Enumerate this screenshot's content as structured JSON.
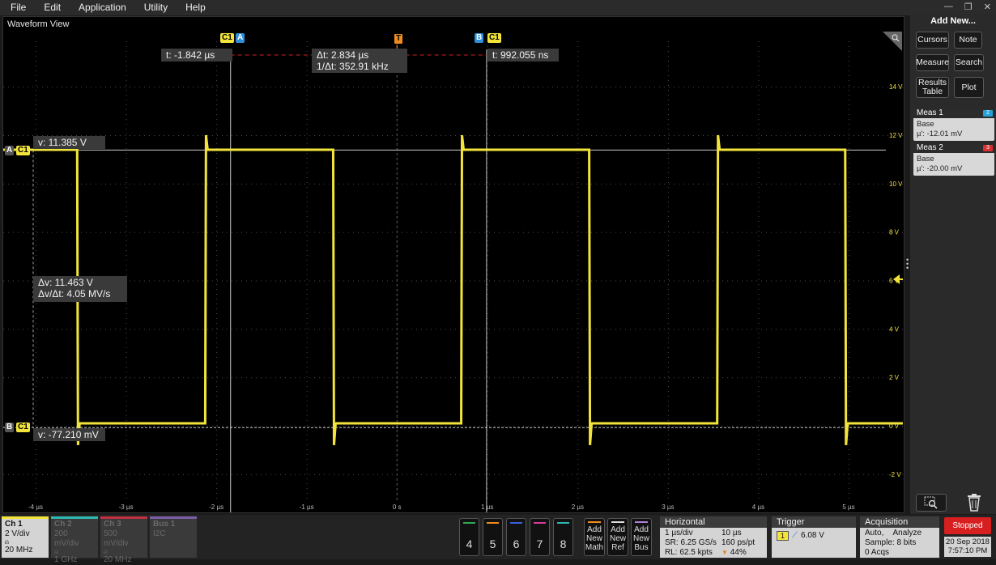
{
  "menu": [
    "File",
    "Edit",
    "Application",
    "Utility",
    "Help"
  ],
  "waveform_view": {
    "title": "Waveform View",
    "cursor_a_time": "t: -1.842 µs",
    "cursor_b_time": "t: 992.055 ns",
    "delta_t": "Δt: 2.834 µs",
    "inv_delta_t": "1/Δt:  352.91 kHz",
    "cursor_a_voltage": "v: 11.385 V",
    "cursor_b_voltage": "v: -77.210 mV",
    "delta_v": "Δv: 11.463 V",
    "dv_dt": "Δv/Δt:  4.05 MV/s",
    "tags": {
      "c1": "C1",
      "a": "A",
      "b": "B",
      "t": "T"
    },
    "y_ticks": [
      "14 V",
      "12 V",
      "10 V",
      "8 V",
      "6 V",
      "4 V",
      "2 V",
      "0 V",
      "-2 V"
    ],
    "x_ticks": [
      "-4 µs",
      "-3 µs",
      "-2 µs",
      "-1 µs",
      "0 s",
      "1 µs",
      "2 µs",
      "3 µs",
      "4 µs",
      "5 µs"
    ],
    "waveform_color": "#f2e43a"
  },
  "right_panel": {
    "title": "Add New...",
    "buttons": [
      "Cursors",
      "Note",
      "Measure",
      "Search",
      "Results Table",
      "Plot"
    ],
    "measurements": [
      {
        "name": "Meas 1",
        "type": "Base",
        "value": "µ': -12.01 mV",
        "badge_color": "#27a0d8"
      },
      {
        "name": "Meas 2",
        "type": "Base",
        "value": "µ': -20.00 mV",
        "badge_color": "#d83030"
      }
    ],
    "icons": [
      "zoom-icon",
      "trash-icon"
    ]
  },
  "channels": [
    {
      "name": "Ch 1",
      "scale": "2 V/div",
      "bw": "20 MHz",
      "active": true,
      "color": "#f2e43a"
    },
    {
      "name": "Ch 2",
      "scale": "200 mV/div",
      "bw": "1 GHz",
      "active": false,
      "color": "#2fb8b0"
    },
    {
      "name": "Ch 3",
      "scale": "500 mV/div",
      "bw": "20 MHz",
      "active": false,
      "color": "#c03040"
    },
    {
      "name": "Bus 1",
      "scale": "I2C",
      "bw": "",
      "active": false,
      "color": "#7a5fa8"
    }
  ],
  "num_buttons": [
    {
      "label": "4",
      "color": "#35a853"
    },
    {
      "label": "5",
      "color": "#f08c1e"
    },
    {
      "label": "6",
      "color": "#3a5fd8"
    },
    {
      "label": "7",
      "color": "#d83a9a"
    },
    {
      "label": "8",
      "color": "#2fb8b0"
    }
  ],
  "add_buttons": [
    {
      "label1": "Add",
      "label2": "New",
      "label3": "Math",
      "color": "#f08c1e"
    },
    {
      "label1": "Add",
      "label2": "New",
      "label3": "Ref",
      "color": "#dddddd"
    },
    {
      "label1": "Add",
      "label2": "New",
      "label3": "Bus",
      "color": "#b080d8"
    }
  ],
  "horizontal": {
    "title": "Horizontal",
    "scale": "1 µs/div",
    "span": "10 µs",
    "sr": "SR: 6.25 GS/s",
    "pt": "160 ps/pt",
    "rl": "RL: 62.5 kpts",
    "pos": "44%"
  },
  "trigger": {
    "title": "Trigger",
    "source": "1",
    "level": "6.08 V"
  },
  "acquisition": {
    "title": "Acquisition",
    "mode": "Auto,",
    "analyze": "Analyze",
    "samples": "Sample: 8 bits",
    "acqs": "0 Acqs"
  },
  "status": {
    "state": "Stopped",
    "date": "20 Sep 2018",
    "time": "7:57:10 PM"
  }
}
